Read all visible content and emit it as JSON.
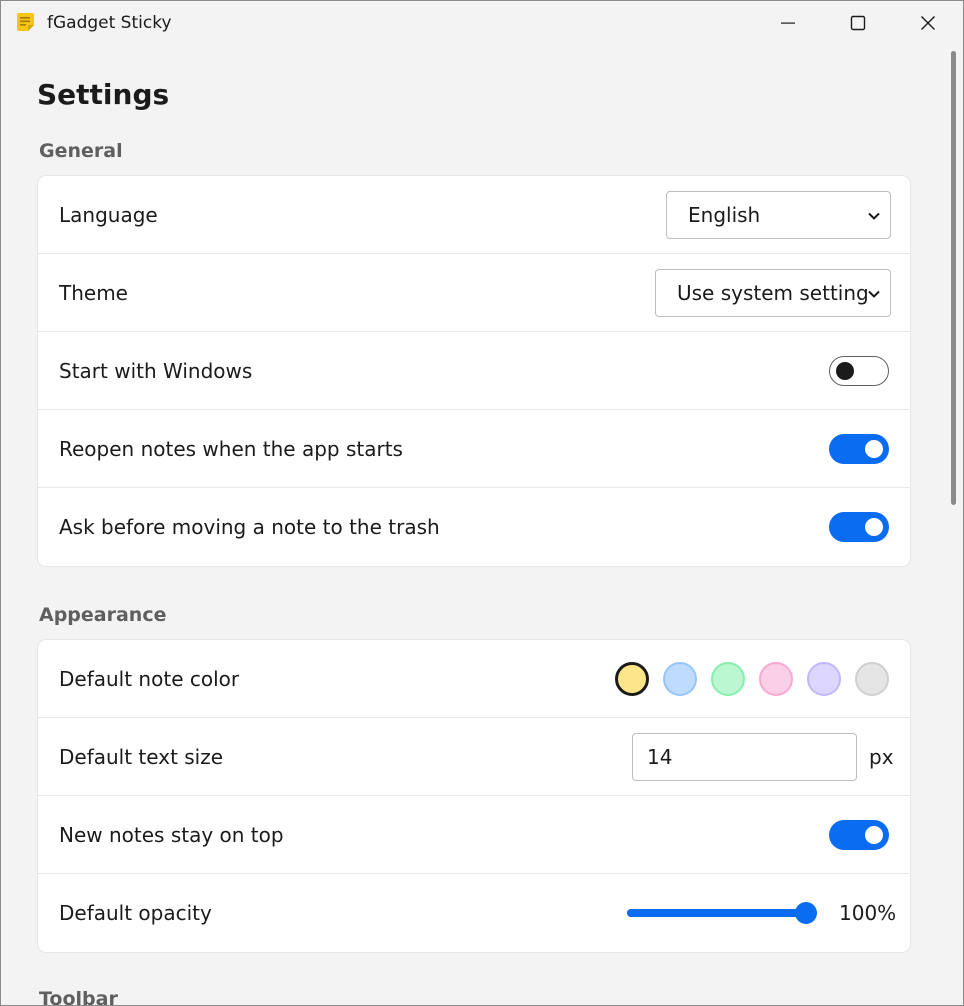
{
  "window": {
    "title": "fGadget Sticky"
  },
  "page": {
    "title": "Settings"
  },
  "general": {
    "title": "General",
    "language": {
      "label": "Language",
      "value": "English"
    },
    "theme": {
      "label": "Theme",
      "value": "Use system setting"
    },
    "start_with_windows": {
      "label": "Start with Windows",
      "checked": false
    },
    "reopen_notes": {
      "label": "Reopen notes when the app starts",
      "checked": true
    },
    "ask_before_trash": {
      "label": "Ask before moving a note to the trash",
      "checked": true
    }
  },
  "appearance": {
    "title": "Appearance",
    "default_note_color": {
      "label": "Default note color",
      "selected": "yellow",
      "swatches": [
        {
          "name": "yellow",
          "fill": "#fde68a",
          "ring": "#1b1b1b"
        },
        {
          "name": "blue",
          "fill": "#bfdbfe",
          "ring": "#93c5fd"
        },
        {
          "name": "green",
          "fill": "#bbf7d0",
          "ring": "#86efac"
        },
        {
          "name": "pink",
          "fill": "#fbcfe8",
          "ring": "#f9a8d4"
        },
        {
          "name": "purple",
          "fill": "#ddd6fe",
          "ring": "#c4b5fd"
        },
        {
          "name": "gray",
          "fill": "#e5e5e5",
          "ring": "#cfcfcf"
        }
      ]
    },
    "default_text_size": {
      "label": "Default text size",
      "value": "14",
      "unit": "px"
    },
    "new_notes_on_top": {
      "label": "New notes stay on top",
      "checked": true
    },
    "default_opacity": {
      "label": "Default opacity",
      "value": 100,
      "value_text": "100%"
    }
  },
  "toolbar": {
    "title": "Toolbar"
  },
  "colors": {
    "accent": "#0a6cf0"
  }
}
